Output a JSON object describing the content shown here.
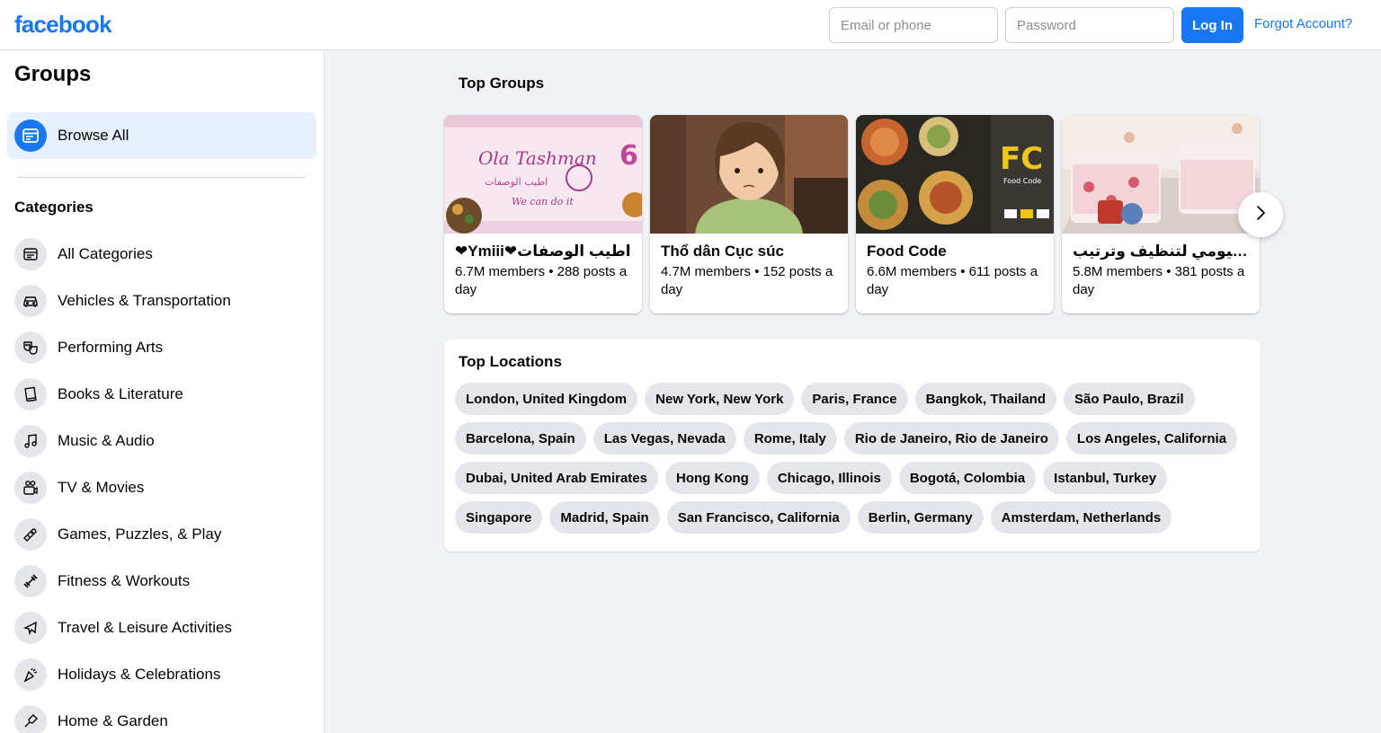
{
  "header": {
    "logo_text": "facebook",
    "email_placeholder": "Email or phone",
    "password_placeholder": "Password",
    "login_label": "Log In",
    "forgot_label": "Forgot Account?"
  },
  "sidebar": {
    "title": "Groups",
    "browse_all": {
      "label": "Browse All",
      "icon": "browse-icon"
    },
    "categories_title": "Categories",
    "categories": [
      {
        "label": "All Categories",
        "icon": "list-icon"
      },
      {
        "label": "Vehicles & Transportation",
        "icon": "car-icon"
      },
      {
        "label": "Performing Arts",
        "icon": "masks-icon"
      },
      {
        "label": "Books & Literature",
        "icon": "book-icon"
      },
      {
        "label": "Music & Audio",
        "icon": "music-note-icon"
      },
      {
        "label": "TV & Movies",
        "icon": "video-camera-icon"
      },
      {
        "label": "Games, Puzzles, & Play",
        "icon": "game-controller-icon"
      },
      {
        "label": "Fitness & Workouts",
        "icon": "dumbbell-icon"
      },
      {
        "label": "Travel & Leisure Activities",
        "icon": "airplane-icon"
      },
      {
        "label": "Holidays & Celebrations",
        "icon": "party-icon"
      },
      {
        "label": "Home & Garden",
        "icon": "shovel-icon"
      }
    ]
  },
  "main": {
    "top_groups_title": "Top Groups",
    "groups": [
      {
        "name": "❤Ymiii❤اطيب الوصفات",
        "meta": "6.7M members • 288 posts a day",
        "image": "ola-tashman-banner"
      },
      {
        "name": "Thổ dân Cục súc",
        "meta": "4.7M members • 152 posts a day",
        "image": "anime-girl"
      },
      {
        "name": "Food Code",
        "meta": "6.6M members • 611 posts a day",
        "image": "food-code-dishes"
      },
      {
        "name": "الروتين اليومي لتنظيف وترتيب",
        "meta": "5.8M members • 381 posts a day",
        "image": "bedroom-girl"
      }
    ],
    "next_icon": "chevron-right-icon",
    "top_locations_title": "Top Locations",
    "locations": [
      "London, United Kingdom",
      "New York, New York",
      "Paris, France",
      "Bangkok, Thailand",
      "São Paulo, Brazil",
      "Barcelona, Spain",
      "Las Vegas, Nevada",
      "Rome, Italy",
      "Rio de Janeiro, Rio de Janeiro",
      "Los Angeles, California",
      "Dubai, United Arab Emirates",
      "Hong Kong",
      "Chicago, Illinois",
      "Bogotá, Colombia",
      "Istanbul, Turkey",
      "Singapore",
      "Madrid, Spain",
      "San Francisco, California",
      "Berlin, Germany",
      "Amsterdam, Netherlands"
    ]
  },
  "colors": {
    "brand": "#1877f2",
    "page_bg": "#f0f2f5",
    "chip_bg": "#e4e6eb",
    "selected_bg": "#e7f0fd"
  }
}
